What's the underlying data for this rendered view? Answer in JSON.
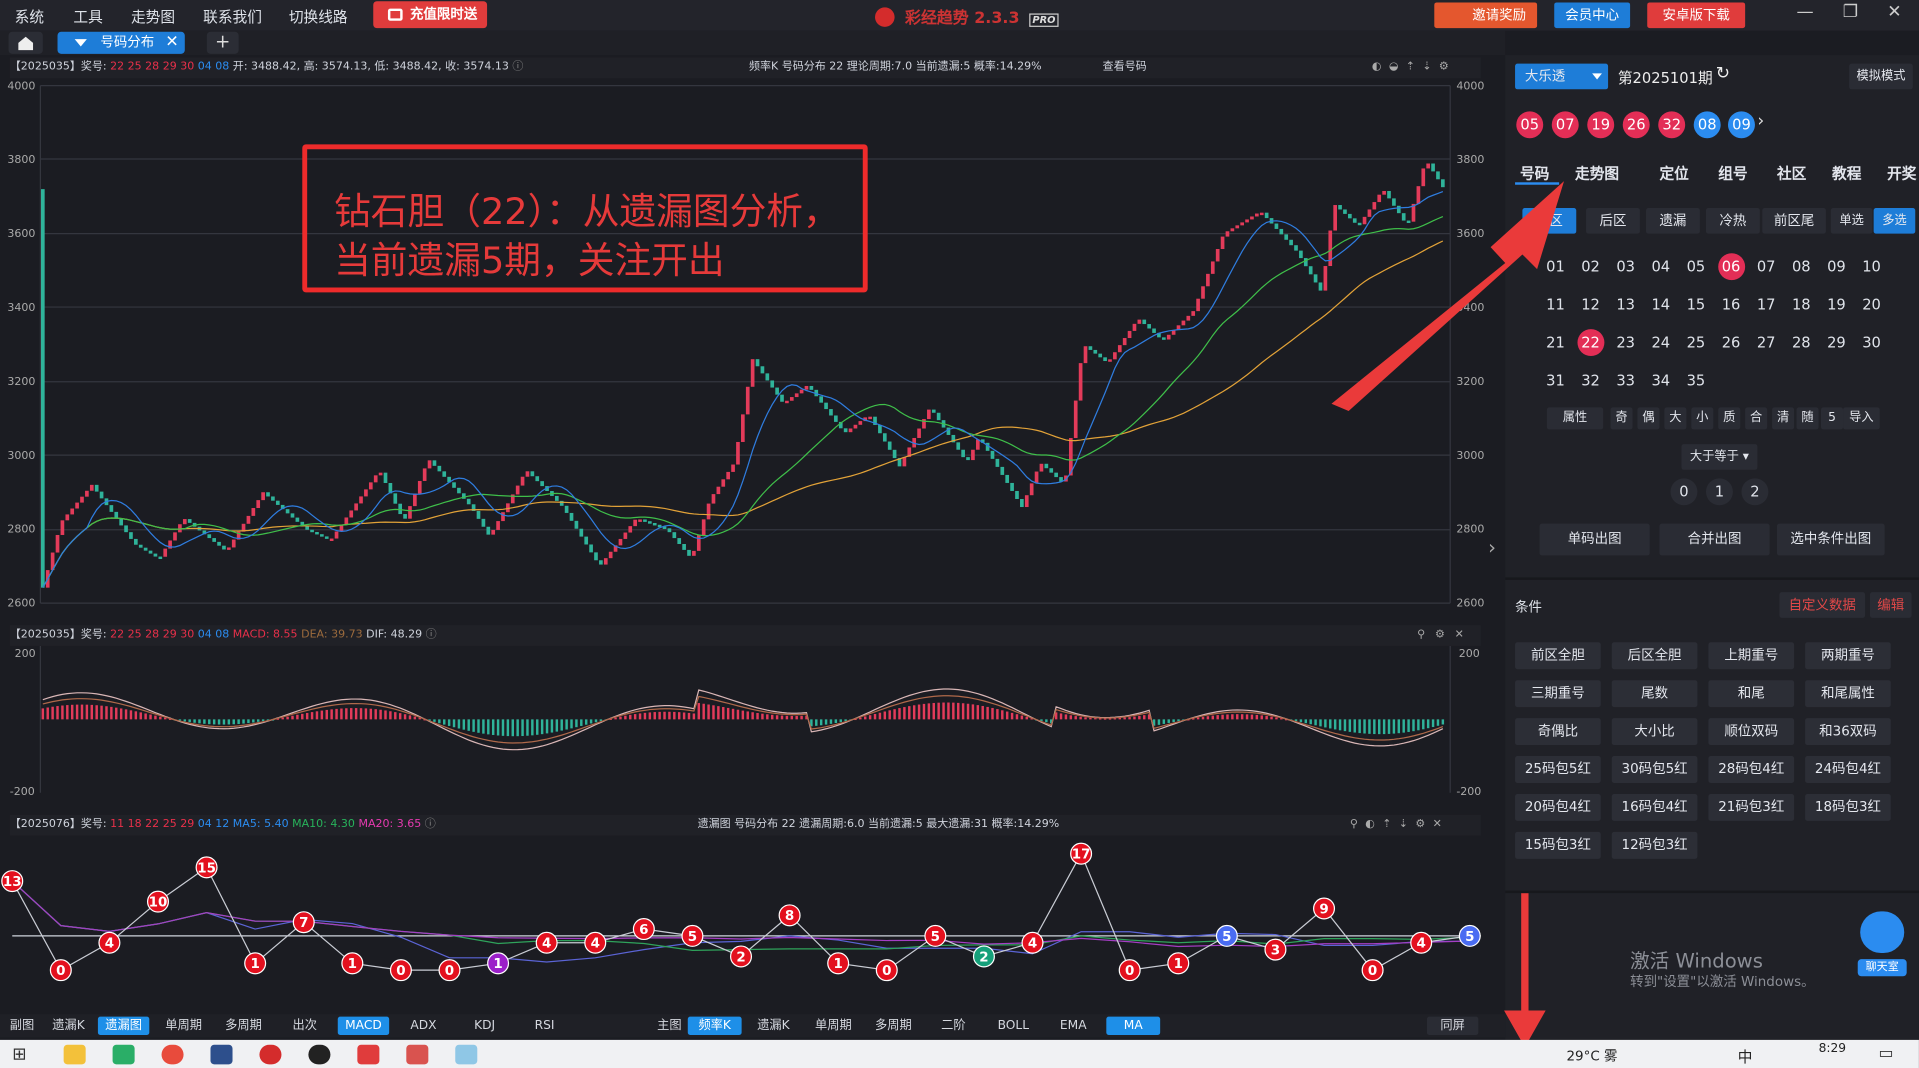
{
  "menu": [
    "系统",
    "工具",
    "走势图",
    "联系我们",
    "切换线路"
  ],
  "recharge_label": "充值限时送",
  "app_title": "彩经趋势",
  "app_version": "2.3.3",
  "app_badge": "PRO",
  "top_buttons": {
    "invite": "邀请奖励",
    "member": "会员中心",
    "android": "安卓版下载"
  },
  "tabs": {
    "active": "号码分布"
  },
  "kline_header": {
    "issue": "【2025035】奖号:",
    "red_numbers": "22 25 28 29 30",
    "blue_numbers": "04 08",
    "ohlc": "开: 3488.42, 高: 3574.13, 低: 3488.42, 收: 3574.13",
    "right_info": "频率K  号码分布  22    理论周期:7.0  当前遗漏:5  概率:14.29%",
    "view_link": "查看号码"
  },
  "kline_axis": [
    "4000",
    "3800",
    "3600",
    "3400",
    "3200",
    "3000",
    "2800",
    "2600"
  ],
  "macd_header": {
    "issue": "【2025035】奖号:",
    "red_numbers": "22 25 28 29 30",
    "blue_numbers": "04 08",
    "macd": "MACD: 8.55",
    "dea": "DEA: 39.73",
    "dif": "DIF: 48.29"
  },
  "macd_axis": [
    "200",
    "-200"
  ],
  "miss_header": {
    "issue": "【2025076】奖号:",
    "red_numbers": "11 18 22 25 29",
    "blue_numbers": "04 12",
    "ma5": "MA5: 5.40",
    "ma10": "MA10: 4.30",
    "ma20": "MA20: 3.65",
    "right_info": "遗漏图  号码分布  22    遗漏周期:6.0  当前遗漏:5  最大遗漏:31  概率:14.29%"
  },
  "miss_points": [
    {
      "v": "13",
      "c": "#e3101e"
    },
    {
      "v": "0",
      "c": "#e3101e"
    },
    {
      "v": "4",
      "c": "#e3101e"
    },
    {
      "v": "10",
      "c": "#e3101e"
    },
    {
      "v": "15",
      "c": "#e3101e"
    },
    {
      "v": "1",
      "c": "#e3101e"
    },
    {
      "v": "7",
      "c": "#e3101e"
    },
    {
      "v": "1",
      "c": "#e3101e"
    },
    {
      "v": "0",
      "c": "#e3101e"
    },
    {
      "v": "0",
      "c": "#e3101e"
    },
    {
      "v": "1",
      "c": "#9b1fc9"
    },
    {
      "v": "4",
      "c": "#e3101e"
    },
    {
      "v": "4",
      "c": "#e3101e"
    },
    {
      "v": "6",
      "c": "#e3101e"
    },
    {
      "v": "5",
      "c": "#e3101e"
    },
    {
      "v": "2",
      "c": "#e3101e"
    },
    {
      "v": "8",
      "c": "#e3101e"
    },
    {
      "v": "1",
      "c": "#e3101e"
    },
    {
      "v": "0",
      "c": "#e3101e"
    },
    {
      "v": "5",
      "c": "#e3101e"
    },
    {
      "v": "2",
      "c": "#15a07a"
    },
    {
      "v": "4",
      "c": "#e3101e"
    },
    {
      "v": "17",
      "c": "#e3101e"
    },
    {
      "v": "0",
      "c": "#e3101e"
    },
    {
      "v": "1",
      "c": "#e3101e"
    },
    {
      "v": "5",
      "c": "#4a6cf2"
    },
    {
      "v": "3",
      "c": "#e3101e"
    },
    {
      "v": "9",
      "c": "#e3101e"
    },
    {
      "v": "0",
      "c": "#e3101e"
    },
    {
      "v": "4",
      "c": "#e3101e"
    },
    {
      "v": "5",
      "c": "#4a6cf2"
    }
  ],
  "annotation": {
    "line1": "钻石胆（22）：从遗漏图分析，",
    "line2": "当前遗漏5期，关注开出"
  },
  "bottom_left": {
    "label": "副图",
    "buttons": [
      "遗漏K",
      "遗漏图",
      "单周期",
      "多周期",
      "出次",
      "MACD",
      "ADX",
      "KDJ",
      "RSI"
    ],
    "active": [
      "遗漏图",
      "MACD"
    ]
  },
  "bottom_right": {
    "label": "主图",
    "buttons": [
      "频率K",
      "遗漏K",
      "单周期",
      "多周期",
      "二阶",
      "BOLL",
      "EMA",
      "MA"
    ],
    "active": [
      "频率K",
      "MA"
    ],
    "split": "同屏"
  },
  "side": {
    "lottery": "大乐透",
    "period": "第2025101期",
    "sim_mode": "模拟模式",
    "red_balls": [
      "05",
      "07",
      "19",
      "26",
      "32"
    ],
    "blue_balls": [
      "08",
      "09"
    ],
    "nav_tabs": [
      "号码",
      "走势图",
      "定位",
      "组号",
      "社区",
      "教程",
      "开奖"
    ],
    "sub_tabs": [
      "前区",
      "后区",
      "遗漏",
      "冷热",
      "前区尾"
    ],
    "single": "单选",
    "multi": "多选",
    "numbers": [
      "01",
      "02",
      "03",
      "04",
      "05",
      "06",
      "07",
      "08",
      "09",
      "10",
      "11",
      "12",
      "13",
      "14",
      "15",
      "16",
      "17",
      "18",
      "19",
      "20",
      "21",
      "22",
      "23",
      "24",
      "25",
      "26",
      "27",
      "28",
      "29",
      "30",
      "31",
      "32",
      "33",
      "34",
      "35"
    ],
    "selected": [
      "06",
      "22"
    ],
    "attrs": [
      "属性",
      "奇",
      "偶",
      "大",
      "小",
      "质",
      "合",
      "清",
      "随",
      "5",
      "导入"
    ],
    "ge_label": "大于等于",
    "counts": [
      "0",
      "1",
      "2"
    ],
    "actions": [
      "单码出图",
      "合并出图",
      "选中条件出图"
    ],
    "cond_title": "条件",
    "custom": "自定义数据",
    "edit": "编辑",
    "conditions": [
      "前区全胆",
      "后区全胆",
      "上期重号",
      "两期重号",
      "三期重号",
      "尾数",
      "和尾",
      "和尾属性",
      "奇偶比",
      "大小比",
      "顺位双码",
      "和36双码",
      "25码包5红",
      "30码包5红",
      "28码包4红",
      "24码包4红",
      "20码包4红",
      "16码包4红",
      "21码包3红",
      "18码包3红",
      "15码包3红",
      "12码包3红"
    ],
    "win_activate": "激活 Windows",
    "win_activate_sub": "转到\"设置\"以激活 Windows。",
    "chat": "聊天室"
  },
  "taskbar": {
    "weather": "29°C 雾",
    "ime": "中",
    "time": "8:29"
  }
}
